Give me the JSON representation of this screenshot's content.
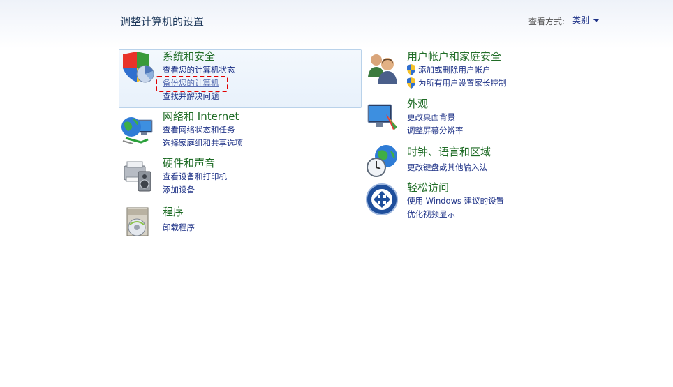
{
  "header": {
    "title": "调整计算机的设置",
    "view_by_label": "查看方式:",
    "view_by_value": "类别"
  },
  "categories": {
    "system_security": {
      "icon": "shield-icon",
      "title": "系统和安全",
      "links": [
        "查看您的计算机状态",
        "备份您的计算机",
        "查找并解决问题"
      ]
    },
    "network": {
      "icon": "network-globe-icon",
      "title": "网络和 Internet",
      "links": [
        "查看网络状态和任务",
        "选择家庭组和共享选项"
      ]
    },
    "hardware": {
      "icon": "printer-speaker-icon",
      "title": "硬件和声音",
      "links": [
        "查看设备和打印机",
        "添加设备"
      ]
    },
    "programs": {
      "icon": "programs-disc-icon",
      "title": "程序",
      "links": [
        "卸载程序"
      ]
    },
    "user_accounts": {
      "icon": "users-icon",
      "title": "用户帐户和家庭安全",
      "links": [
        "添加或删除用户帐户",
        "为所有用户设置家长控制"
      ]
    },
    "appearance": {
      "icon": "monitor-paint-icon",
      "title": "外观",
      "links": [
        "更改桌面背景",
        "调整屏幕分辨率"
      ]
    },
    "clock_region": {
      "icon": "clock-globe-icon",
      "title": "时钟、语言和区域",
      "links": [
        "更改键盘或其他输入法"
      ]
    },
    "ease_access": {
      "icon": "ease-of-access-icon",
      "title": "轻松访问",
      "links": [
        "使用 Windows 建议的设置",
        "优化视频显示"
      ]
    }
  },
  "colors": {
    "title_green": "#1f6c26",
    "link_blue": "#1e3287",
    "highlight_red": "#e00000"
  }
}
